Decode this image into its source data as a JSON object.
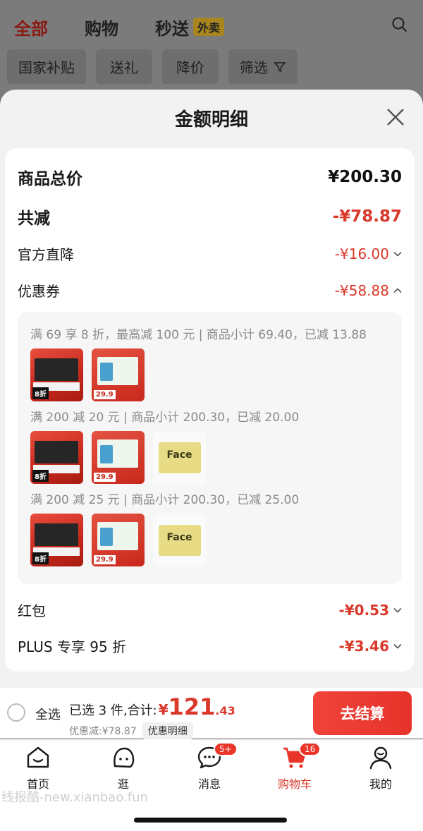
{
  "top_tabs": [
    {
      "label": "全部",
      "active": true
    },
    {
      "label": "购物",
      "active": false
    },
    {
      "label": "秒送",
      "active": false
    }
  ],
  "takeout_badge": "外卖",
  "filter_chips": [
    "国家补贴",
    "送礼",
    "降价",
    "筛选"
  ],
  "sheet": {
    "title": "金额明细",
    "rows": {
      "total_label": "商品总价",
      "total_value": "¥200.30",
      "reduce_label": "共减",
      "reduce_value": "-¥78.87",
      "direct_label": "官方直降",
      "direct_value": "-¥16.00",
      "coupon_label": "优惠券",
      "coupon_value": "-¥58.88",
      "redpack_label": "红包",
      "redpack_value": "-¥0.53",
      "plus_label": "PLUS 专享 95 折",
      "plus_value": "-¥3.46"
    },
    "coupons": [
      {
        "text": "满 69 享 8 折，最高减 100 元 | 商品小计 69.40，已减 13.88"
      },
      {
        "text": "满 200 减 20 元 | 商品小计 200.30，已减 20.00"
      },
      {
        "text": "满 200 减 25 元 | 商品小计 200.30，已减 25.00"
      }
    ],
    "thumb_tags": {
      "red": "8折",
      "green": "29.9",
      "face": "Face"
    }
  },
  "checkout": {
    "select_all": "全选",
    "summary_label": "已选 3 件,合计:",
    "currency": "¥",
    "total_int": "121",
    "total_dec": ".43",
    "discount_text": "优惠减:¥78.87",
    "detail_link": "优惠明细",
    "pay_button": "去结算"
  },
  "tabbar": [
    {
      "label": "首页",
      "icon": "home-icon"
    },
    {
      "label": "逛",
      "icon": "browse-icon"
    },
    {
      "label": "消息",
      "icon": "message-icon",
      "badge": "5+"
    },
    {
      "label": "购物车",
      "icon": "cart-icon",
      "badge": "16",
      "active": true
    },
    {
      "label": "我的",
      "icon": "profile-icon"
    }
  ],
  "watermark": "线报酷-new.xianbao.fun",
  "colors": {
    "accent": "#e9352a",
    "price": "#d9382a"
  }
}
